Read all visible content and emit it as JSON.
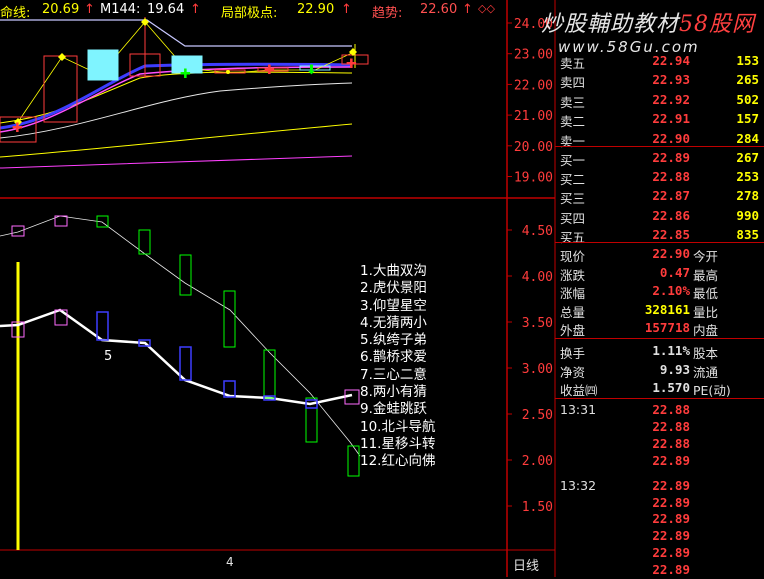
{
  "topbar": {
    "life_line_label": "命线:",
    "life_line_value": "20.69",
    "life_line_arrow": "↑",
    "m144_label": "M144:",
    "m144_value": "19.64",
    "m144_arrow": "↑",
    "local_extreme_label": "局部极点:",
    "local_extreme_value": "22.90",
    "local_extreme_arrow": "↑",
    "trend_label": "趋势:",
    "trend_value": "22.60",
    "trend_arrow": "↑",
    "circles": "◇◇"
  },
  "price_axis": [
    "24.00",
    "23.00",
    "22.00",
    "21.00",
    "20.00",
    "19.00"
  ],
  "indicator_axis": [
    "4.50",
    "4.00",
    "3.50",
    "3.00",
    "2.50",
    "2.00",
    "1.50"
  ],
  "indicator_marker": "5",
  "legend": [
    "1.大曲双沟",
    "2.虎伏景阳",
    "3.仰望星空",
    "4.无猜两小",
    "5.纨绔子弟",
    "6.鹊桥求爱",
    "7.三心二意",
    "8.两小有猜",
    "9.金蛙跳跃",
    "10.北斗导航",
    "11.星移斗转",
    "12.红心向佛"
  ],
  "watermark": {
    "main": "炒股輔助教材",
    "brand": "58股网",
    "url": "www.58Gu.com"
  },
  "bottom": {
    "day_label": "日线",
    "marker": "4"
  },
  "order_book": {
    "sell": [
      {
        "label": "卖五",
        "price": "22.94",
        "volume": "153"
      },
      {
        "label": "卖四",
        "price": "22.93",
        "volume": "265"
      },
      {
        "label": "卖三",
        "price": "22.92",
        "volume": "502"
      },
      {
        "label": "卖二",
        "price": "22.91",
        "volume": "157"
      },
      {
        "label": "卖一",
        "price": "22.90",
        "volume": "284"
      }
    ],
    "buy": [
      {
        "label": "买一",
        "price": "22.89",
        "volume": "267"
      },
      {
        "label": "买二",
        "price": "22.88",
        "volume": "253"
      },
      {
        "label": "买三",
        "price": "22.87",
        "volume": "278"
      },
      {
        "label": "买四",
        "price": "22.86",
        "volume": "990"
      },
      {
        "label": "买五",
        "price": "22.85",
        "volume": "835"
      }
    ]
  },
  "stats": [
    {
      "label": "现价",
      "value": "22.90",
      "label2": "今开"
    },
    {
      "label": "涨跌",
      "value": "0.47",
      "label2": "最高"
    },
    {
      "label": "涨幅",
      "value": "2.10%",
      "label2": "最低"
    },
    {
      "label": "总量",
      "value": "328161",
      "label2": "量比"
    },
    {
      "label": "外盘",
      "value": "157718",
      "label2": "内盘"
    }
  ],
  "stats2": [
    {
      "label": "换手",
      "value": "1.11%",
      "label2": "股本"
    },
    {
      "label": "净资",
      "value": "9.93",
      "label2": "流通"
    },
    {
      "label": "收益㈣",
      "value": "1.570",
      "label2": "PE(动)"
    }
  ],
  "ticks": [
    {
      "time": "13:31",
      "price": "22.88"
    },
    {
      "time": "",
      "price": "22.88"
    },
    {
      "time": "",
      "price": "22.88"
    },
    {
      "time": "",
      "price": "22.89"
    },
    {
      "time": "13:32",
      "price": "22.89"
    },
    {
      "time": "",
      "price": "22.89"
    },
    {
      "time": "",
      "price": "22.89"
    },
    {
      "time": "",
      "price": "22.89"
    },
    {
      "time": "",
      "price": "22.89"
    },
    {
      "time": "",
      "price": "22.89"
    }
  ],
  "colors": {
    "up": "#ff3c3c",
    "highlight": "#ffff00",
    "panel_border": "#c00000",
    "cyan_box": "#7ff4ff"
  }
}
